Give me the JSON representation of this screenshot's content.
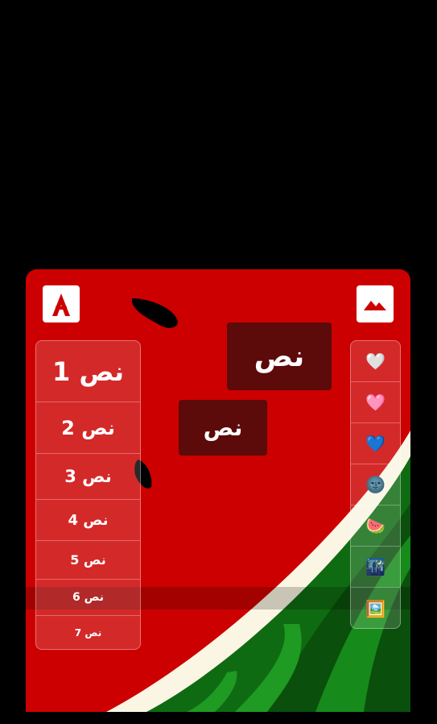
{
  "app": {
    "logo_icon": "adobe-a-logo-icon",
    "image_button_icon": "image-mountains-icon",
    "accent_color": "#cc0000",
    "label_bg_color": "#5c0a0a"
  },
  "canvas": {
    "labels": [
      "نص",
      "نص"
    ]
  },
  "text_styles": [
    {
      "label": "نص 1",
      "font_size": 32
    },
    {
      "label": "نص 2",
      "font_size": 24
    },
    {
      "label": "نص 3",
      "font_size": 21
    },
    {
      "label": "نص 4",
      "font_size": 18
    },
    {
      "label": "نص 5",
      "font_size": 16
    },
    {
      "label": "نص 6",
      "font_size": 14
    },
    {
      "label": "نص 7",
      "font_size": 12
    }
  ],
  "emoji_palette": [
    {
      "name": "white-heart-icon",
      "glyph": "🤍"
    },
    {
      "name": "pink-heart-icon",
      "glyph": "🩷"
    },
    {
      "name": "blue-heart-icon",
      "glyph": "💙"
    },
    {
      "name": "new-moon-face-icon",
      "glyph": "🌚"
    },
    {
      "name": "watermelon-icon",
      "glyph": "🍉"
    },
    {
      "name": "city-night-icon",
      "glyph": "🌃"
    },
    {
      "name": "framed-picture-icon",
      "glyph": "🖼️"
    }
  ]
}
